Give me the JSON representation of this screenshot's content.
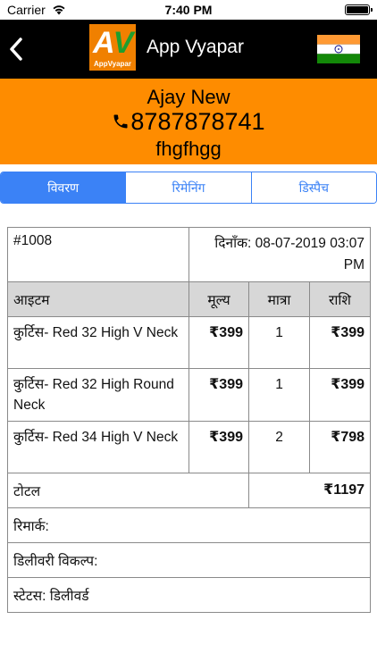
{
  "status_bar": {
    "carrier": "Carrier",
    "time": "7:40 PM"
  },
  "nav": {
    "title": "App Vyapar",
    "logo_letter_a": "A",
    "logo_letter_v": "V",
    "logo_word": "AppVyapar",
    "back_icon": "chevron-left-icon",
    "flag_icon": "india-flag-icon"
  },
  "customer": {
    "name": "Ajay New",
    "phone": "8787878741",
    "note": "fhgfhgg"
  },
  "tabs": [
    {
      "label": "विवरण",
      "active": true
    },
    {
      "label": "रिमेनिंग",
      "active": false
    },
    {
      "label": "डिस्पैच",
      "active": false
    }
  ],
  "order": {
    "number": "#1008",
    "date": "दिनाँक: 08-07-2019 03:07 PM",
    "headers": {
      "item": "आइटम",
      "price": "मूल्य",
      "qty": "मात्रा",
      "amount": "राशि"
    },
    "items": [
      {
        "name": "कुर्टिस- Red 32 High V Neck",
        "price": "₹399",
        "qty": "1",
        "amount": "₹399"
      },
      {
        "name": "कुर्टिस- Red 32 High Round Neck",
        "price": "₹399",
        "qty": "1",
        "amount": "₹399"
      },
      {
        "name": "कुर्टिस- Red 34 High V Neck",
        "price": "₹399",
        "qty": "2",
        "amount": "₹798"
      }
    ],
    "total_label": "टोटल",
    "total_value": "₹1197",
    "remark": "रिमार्क:",
    "delivery_option": "डिलीवरी विकल्प:",
    "status": "स्टेटस: डिलीवर्ड"
  },
  "colors": {
    "header_orange": "#fe8c00",
    "tab_blue": "#3b82f6",
    "nav_black": "#000000"
  }
}
